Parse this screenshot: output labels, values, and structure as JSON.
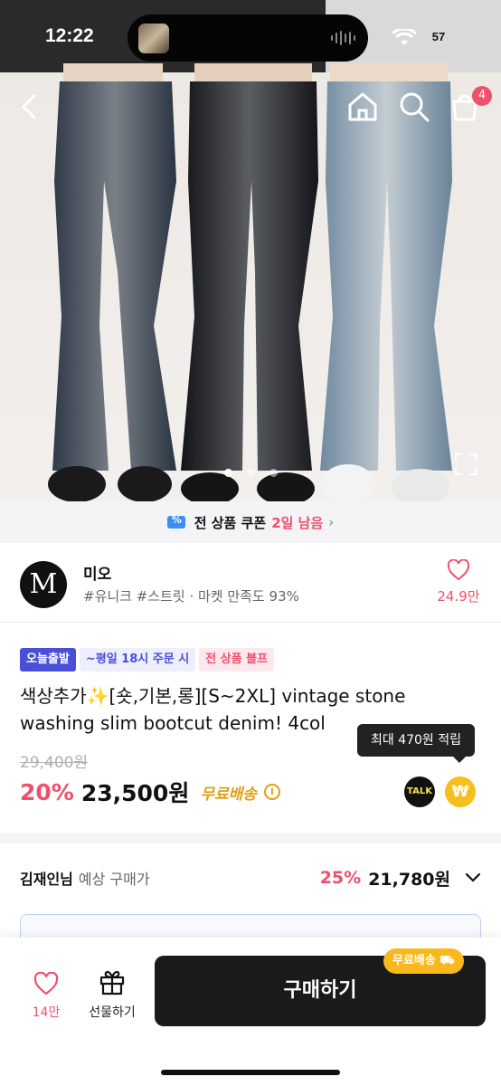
{
  "status_bar": {
    "time": "12:22",
    "battery": "57"
  },
  "header": {
    "cart_count": "4"
  },
  "gallery": {
    "total": 3,
    "current": 1
  },
  "coupon_banner": {
    "text": "전 상품 쿠폰",
    "highlight": "2일 남음"
  },
  "seller": {
    "logo_letter": "M",
    "name": "미오",
    "tags": "#유니크 #스트릿 · 마켓 만족도 93%",
    "like_count": "24.9만"
  },
  "product": {
    "tags": [
      "오늘출발",
      "~평일 18시 주문 시",
      "전 상품 블프"
    ],
    "title": "색상추가✨[숏,기본,롱][S~2XL] vintage stone washing slim bootcut denim! 4col",
    "original_price": "29,400원",
    "discount": "20%",
    "price": "23,500원",
    "shipping": "무료배송",
    "tooltip": "최대 470원 적립",
    "talk_label": "TALK",
    "point_symbol": "₩"
  },
  "member_price": {
    "name": "김재인님",
    "label": "예상 구매가",
    "discount": "25%",
    "price": "21,780원"
  },
  "bottom_bar": {
    "like_count": "14만",
    "gift_label": "선물하기",
    "buy_label": "구매하기",
    "shipping_badge": "무료배송"
  },
  "colors": {
    "accent_pink": "#f0506e",
    "brand_blue": "#4a4fd8",
    "shipping_yellow": "#e2a011"
  }
}
